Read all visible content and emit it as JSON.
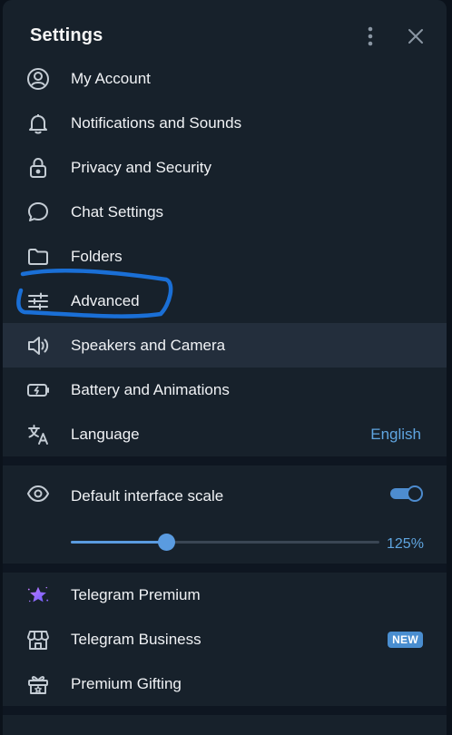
{
  "header": {
    "title": "Settings",
    "more_icon": "kebab-icon",
    "close_icon": "close-icon"
  },
  "menu": [
    {
      "id": "my-account",
      "label": "My Account",
      "icon": "person-circle-icon"
    },
    {
      "id": "notifications",
      "label": "Notifications and Sounds",
      "icon": "bell-icon"
    },
    {
      "id": "privacy",
      "label": "Privacy and Security",
      "icon": "lock-icon"
    },
    {
      "id": "chat-settings",
      "label": "Chat Settings",
      "icon": "chat-bubble-icon"
    },
    {
      "id": "folders",
      "label": "Folders",
      "icon": "folder-icon"
    },
    {
      "id": "advanced",
      "label": "Advanced",
      "icon": "sliders-icon"
    },
    {
      "id": "speakers",
      "label": "Speakers and Camera",
      "icon": "speaker-icon"
    },
    {
      "id": "battery",
      "label": "Battery and Animations",
      "icon": "battery-icon"
    },
    {
      "id": "language",
      "label": "Language",
      "icon": "translate-icon",
      "value": "English"
    }
  ],
  "scale": {
    "label": "Default interface scale",
    "icon": "eye-icon",
    "enabled": true,
    "value_text": "125%",
    "slider_fraction": 0.31
  },
  "premium": [
    {
      "id": "premium",
      "label": "Telegram Premium",
      "icon": "star-icon"
    },
    {
      "id": "business",
      "label": "Telegram Business",
      "icon": "store-icon",
      "badge": "NEW"
    },
    {
      "id": "gifting",
      "label": "Premium Gifting",
      "icon": "gift-icon"
    }
  ],
  "colors": {
    "panel_bg": "#17212b",
    "accent": "#5fa5e0",
    "annotation": "#1a6fd6",
    "premium_star": "#9b6bff"
  }
}
